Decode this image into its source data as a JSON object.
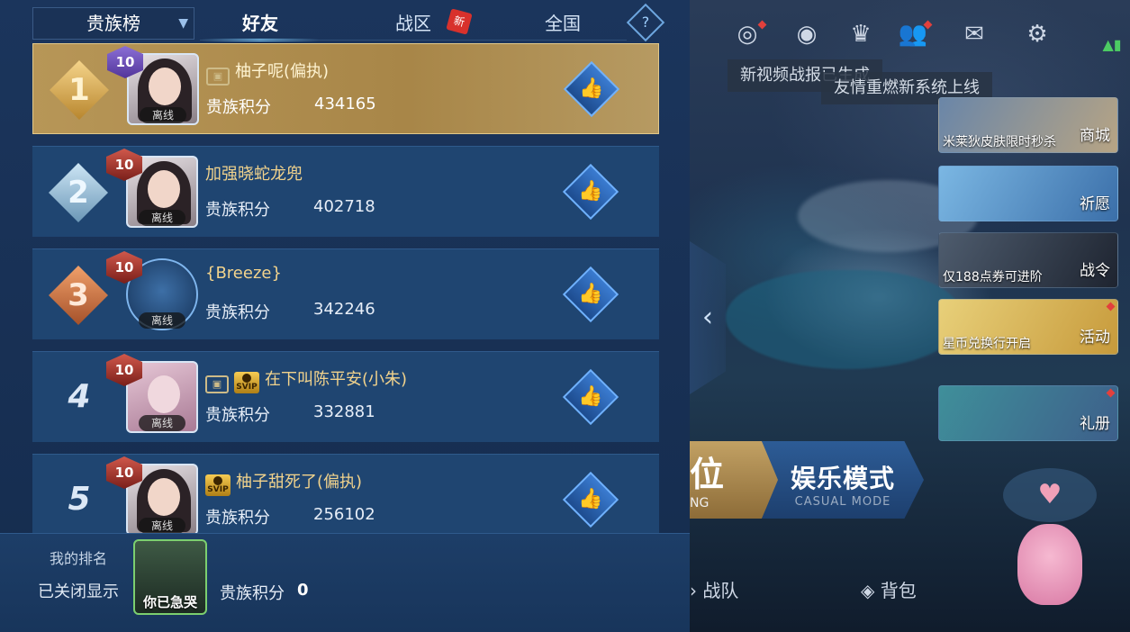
{
  "tabs": {
    "dropdown_label": "贵族榜",
    "items": [
      "好友",
      "战区",
      "全国"
    ],
    "active": "好友",
    "new_badge": "新",
    "help": "?"
  },
  "leaderboard": {
    "score_label": "贵族积分",
    "offline_label": "离线",
    "rows": [
      {
        "rank": "1",
        "level": "10",
        "name": "柚子呢(偏执)",
        "score": "434165"
      },
      {
        "rank": "2",
        "level": "10",
        "name": "加强晓蛇龙兜",
        "score": "402718"
      },
      {
        "rank": "3",
        "level": "10",
        "name": "{Breeze}",
        "score": "342246"
      },
      {
        "rank": "4",
        "level": "10",
        "name": "在下叫陈平安(小朱)",
        "score": "332881"
      },
      {
        "rank": "5",
        "level": "10",
        "name": "柚子甜死了(偏执)",
        "score": "256102"
      }
    ]
  },
  "my_rank": {
    "label": "我的排名",
    "status": "已关闭显示",
    "nickname": "你已急哭",
    "score_label": "贵族积分",
    "score": "0"
  },
  "scene": {
    "notice_1": "新视频战报已生成",
    "notice_2": "友情重燃新系统上线",
    "cards": [
      {
        "caption": "米莱狄皮肤限时秒杀",
        "tag": "商城"
      },
      {
        "caption": "",
        "tag": "祈愿"
      },
      {
        "caption": "仅188点券可进阶",
        "tag": "战令"
      },
      {
        "caption": "星币兑换行开启",
        "tag": "活动"
      },
      {
        "caption": "",
        "tag": "礼册"
      }
    ],
    "mode_left": "位",
    "mode_left_sub": "NG",
    "mode_right": "娱乐模式",
    "mode_right_sub": "CASUAL MODE",
    "nav_team": "战队",
    "nav_bag": "背包",
    "heart": "♥"
  },
  "colors": {
    "gold_row": "#a88648",
    "row_blue": "#1f4571",
    "name_gold": "#f2d38c",
    "accent_blue": "#7fd0ff"
  }
}
